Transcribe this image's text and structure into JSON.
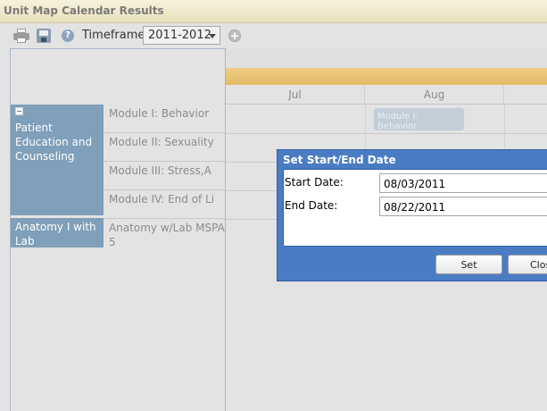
{
  "window": {
    "title": "Unit Map Calendar Results"
  },
  "toolbar": {
    "icons": [
      "printer-icon",
      "save-icon",
      "help-icon",
      "add-icon"
    ],
    "timeframe_label": "Timeframe:",
    "timeframe_value": "2011-2012"
  },
  "timeline": {
    "months": [
      "Jul",
      "Aug"
    ]
  },
  "programs": [
    {
      "name": "Patient Education and Counseling",
      "modules": [
        "Module I: Behavior",
        "Module II: Sexuality",
        "Module III: Stress,A",
        "Module IV: End of Li"
      ]
    },
    {
      "name": "Anatomy I with Lab",
      "modules": [
        "Anatomy w/Lab MSPA 5"
      ]
    }
  ],
  "events": [
    {
      "label": "Module I: Behavior",
      "month": "Aug"
    }
  ],
  "dialog": {
    "title": "Set Start/End Date",
    "start_label": "Start Date:",
    "start_value": "08/03/2011",
    "end_label": "End Date:",
    "end_value": "08/22/2011",
    "set_label": "Set",
    "close_label": "Close"
  },
  "colors": {
    "title_bar": "#efe8ca",
    "header_band": "#e9c271",
    "program_cell": "#7f9fba",
    "dialog_frame": "#4a7cc4"
  }
}
